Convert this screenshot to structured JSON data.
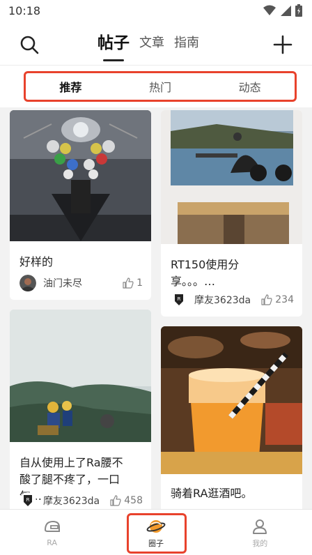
{
  "status": {
    "time": "10:18"
  },
  "header": {
    "tabs": [
      {
        "label": "帖子"
      },
      {
        "label": "文章"
      },
      {
        "label": "指南"
      }
    ]
  },
  "sub_tabs": [
    {
      "label": "推荐"
    },
    {
      "label": "热门"
    },
    {
      "label": "动态"
    }
  ],
  "posts": [
    {
      "title": "好样的",
      "author": "油门未尽",
      "likes": "1"
    },
    {
      "title": "RT150使用分享。。。…",
      "author": "摩友3623da",
      "likes": "234"
    },
    {
      "title": "自从使用上了Ra腰不酸了腿不疼了，一口气…",
      "author": "摩友3623da",
      "likes": "458"
    },
    {
      "title": "骑着RA逛酒吧。",
      "author": "",
      "likes": ""
    }
  ],
  "bottom_nav": [
    {
      "label": "RA"
    },
    {
      "label": "圈子"
    },
    {
      "label": "我的"
    }
  ],
  "colors": {
    "highlight": "#e8422c",
    "accent_orange": "#f39a2b"
  }
}
